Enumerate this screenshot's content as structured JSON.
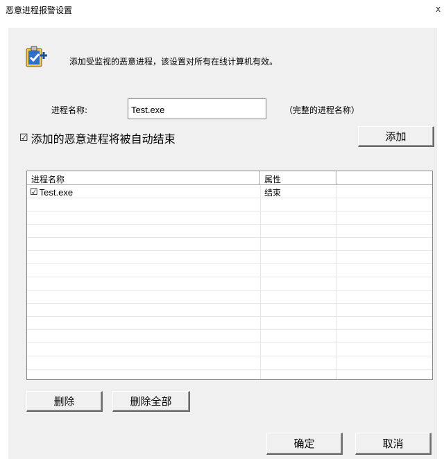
{
  "window": {
    "title": "恶意进程报警设置",
    "close_label": "x"
  },
  "description": "添加受监视的恶意进程，该设置对所有在线计算机有效。",
  "process_name": {
    "label": "进程名称:",
    "value": "Test.exe",
    "hint": "（完整的进程名称）"
  },
  "auto_end": {
    "checked": true,
    "check_glyph": "☑",
    "label": "添加的恶意进程将被自动结束"
  },
  "buttons": {
    "add": "添加",
    "delete": "删除",
    "delete_all": "删除全部",
    "ok": "确定",
    "cancel": "取消"
  },
  "list": {
    "headers": [
      "进程名称",
      "属性",
      ""
    ],
    "rows": [
      {
        "checked": true,
        "check_glyph": "☑",
        "name": "Test.exe",
        "attribute": "结束"
      }
    ]
  },
  "icons": {
    "app": "shield-check-icon"
  }
}
